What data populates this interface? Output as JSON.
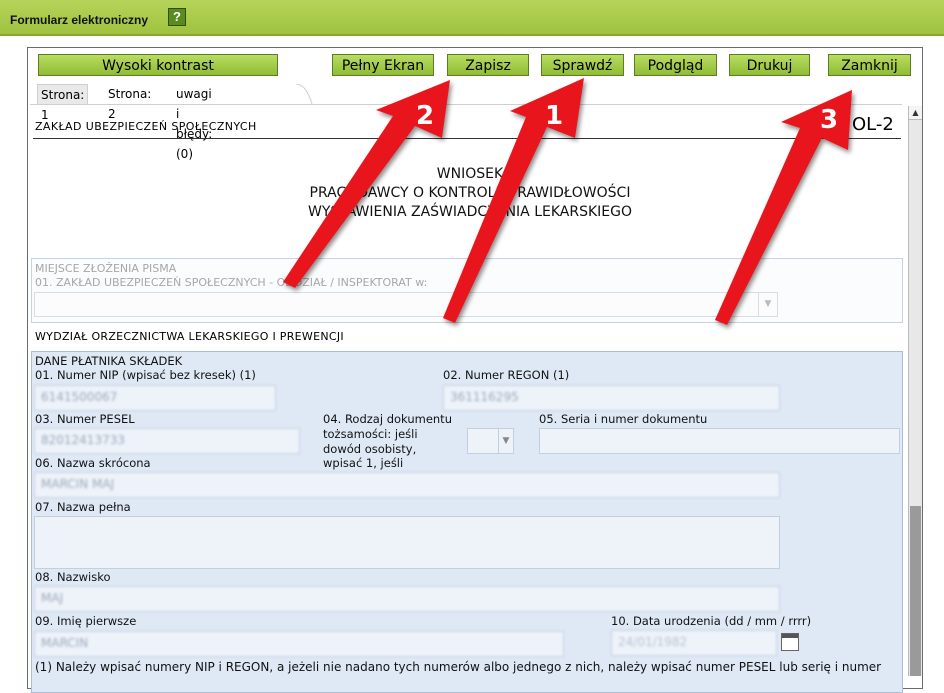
{
  "header": {
    "title": "Formularz elektroniczny",
    "help": "?"
  },
  "toolbar": {
    "contrast": "Wysoki kontrast",
    "fullscreen": "Pełny Ekran",
    "save": "Zapisz",
    "check": "Sprawdź",
    "preview": "Podgląd",
    "print": "Drukuj",
    "close": "Zamknij"
  },
  "tabs": [
    "Strona: 1",
    "Strona: 2",
    "uwagi i błędy: (0)"
  ],
  "form": {
    "org": "ZAKŁAD UBEZPIECZEŃ SPOŁECZNYCH",
    "code": "OL-2",
    "title_lines": [
      "WNIOSEK",
      "PRACODAWCY O KONTROLĘ PRAWIDŁOWOŚCI",
      "WYSTAWIENIA ZAŚWIADCZENIA LEKARSKIEGO"
    ],
    "place_heading": "MIEJSCE ZŁOŻENIA PISMA",
    "place_label": "01. ZAKŁAD UBEZPIECZEŃ SPOŁECZNYCH - ODDZIAŁ / INSPEKTORAT w:",
    "dept": "WYDZIAŁ ORZECZNICTWA LEKARSKIEGO I PREWENCJI",
    "payer_heading": "DANE PŁATNIKA SKŁADEK",
    "nip_label": "01. Numer NIP (wpisać bez kresek) (1)",
    "nip_value": "6141500067",
    "regon_label": "02. Numer REGON (1)",
    "regon_value": "361116295",
    "pesel_label": "03. Numer PESEL",
    "pesel_value": "82012413733",
    "doctype_label": [
      "04. Rodzaj dokumentu",
      "tożsamości: jeśli",
      "dowód osobisty,",
      "wpisać 1, jeśli"
    ],
    "docnum_label": "05. Seria i numer dokumentu",
    "short_name_label": "06. Nazwa skrócona",
    "short_name_value": "MARCIN MAJ",
    "full_name_label": "07. Nazwa pełna",
    "surname_label": "08. Nazwisko",
    "surname_value": "MAJ",
    "firstname_label": "09. Imię pierwsze",
    "firstname_value": "MARCIN",
    "birthdate_label": "10. Data urodzenia (dd / mm / rrrr)",
    "birthdate_value": "24/01/1982",
    "footnote": "(1) Należy wpisać numery NIP i REGON, a jeżeli nie nadano tych numerów albo jednego z nich, należy wpisać numer PESEL lub serię i numer"
  },
  "annotations": [
    "2",
    "1",
    "3"
  ],
  "colors": {
    "accent_green": "#9fc23f",
    "arrow_red": "#e8161b",
    "panel_blue": "#dfe9f6"
  }
}
